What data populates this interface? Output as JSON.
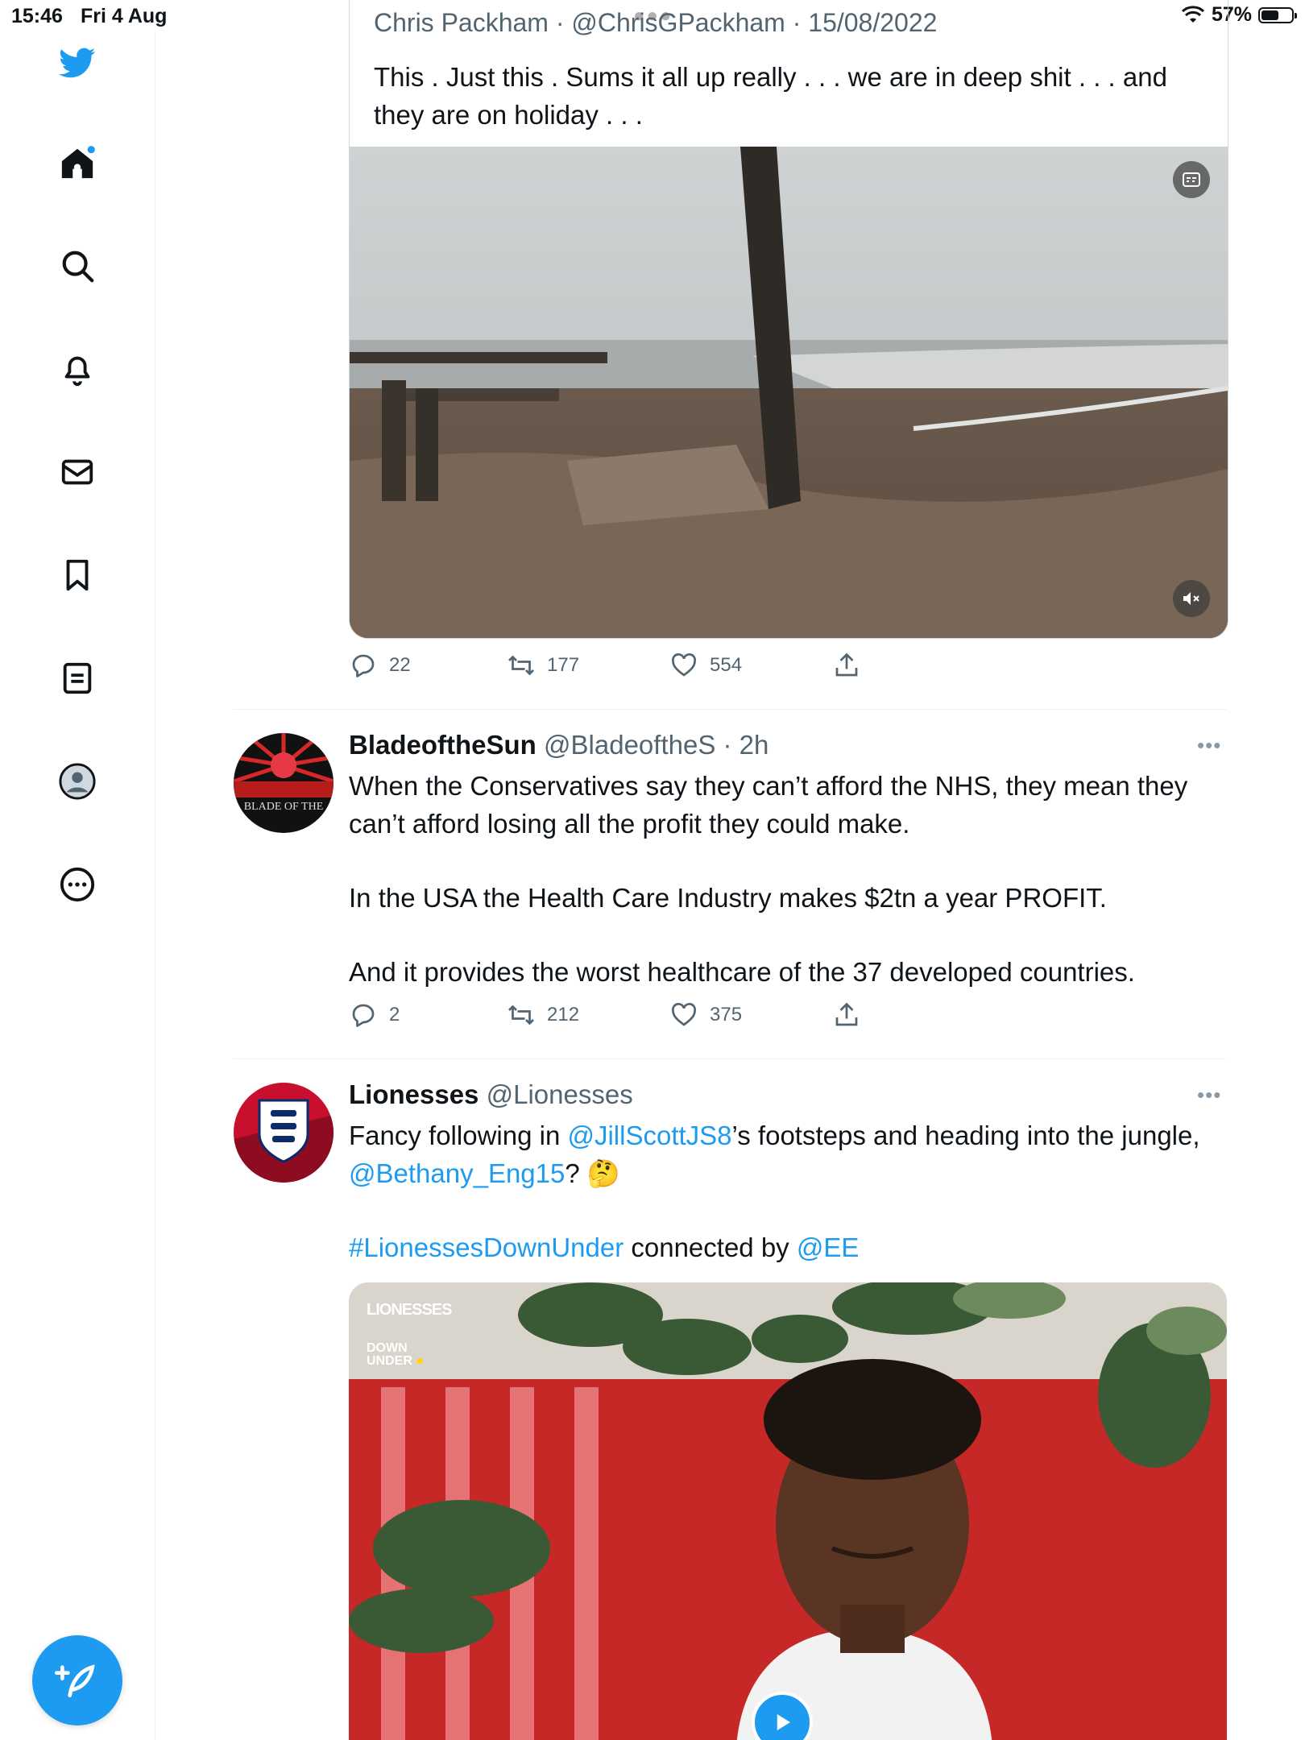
{
  "status_bar": {
    "time": "15:46",
    "date": "Fri 4 Aug",
    "battery": "57%",
    "battery_level": 0.57
  },
  "sidebar": {
    "items": [
      {
        "icon": "twitter-logo-icon"
      },
      {
        "icon": "home-icon"
      },
      {
        "icon": "search-icon"
      },
      {
        "icon": "bell-icon"
      },
      {
        "icon": "mail-icon"
      },
      {
        "icon": "bookmark-icon"
      },
      {
        "icon": "list-icon"
      },
      {
        "icon": "profile-icon"
      },
      {
        "icon": "more-circle-icon"
      }
    ],
    "compose_icon": "compose-feather-icon"
  },
  "colors": {
    "accent": "#1d9bf0",
    "text": "#0f1419",
    "muted": "#536471"
  },
  "quoted_tweet": {
    "header": "Chris Packham · @ChrisGPackham · 15/08/2022",
    "text": "This . Just this . Sums it all up really . . . we are in deep shit . . . and they are on holiday . . ."
  },
  "first_actions": {
    "replies": "22",
    "retweets": "177",
    "likes": "554"
  },
  "tweets": [
    {
      "display_name": "BladeoftheSun",
      "handle": "@BladeoftheS",
      "time": "· 2h",
      "avatar_text": "BLADE OF THE",
      "paragraphs": [
        "When the Conservatives say they can’t afford the NHS, they mean they can’t afford losing all the profit they could make.",
        "In the USA the Health Care Industry makes $2tn a year PROFIT.",
        "And it provides the worst healthcare of the 37 developed countries."
      ],
      "actions": {
        "replies": "2",
        "retweets": "212",
        "likes": "375"
      }
    },
    {
      "display_name": "Lionesses",
      "handle": "@Lionesses",
      "line1_pre": "Fancy following in ",
      "mention1": "@JillScottJS8",
      "line1_post": "’s footsteps and heading into the jungle, ",
      "mention2": "@Bethany_Eng15",
      "line1_end": "? 🤔",
      "hashtag": "#LionessesDownUnder",
      "line2_mid": " connected by ",
      "mention3": "@EE",
      "video_badge_line1": "LIONESSES",
      "video_badge_line2": "DOWN",
      "video_badge_line3": "UNDER"
    }
  ]
}
